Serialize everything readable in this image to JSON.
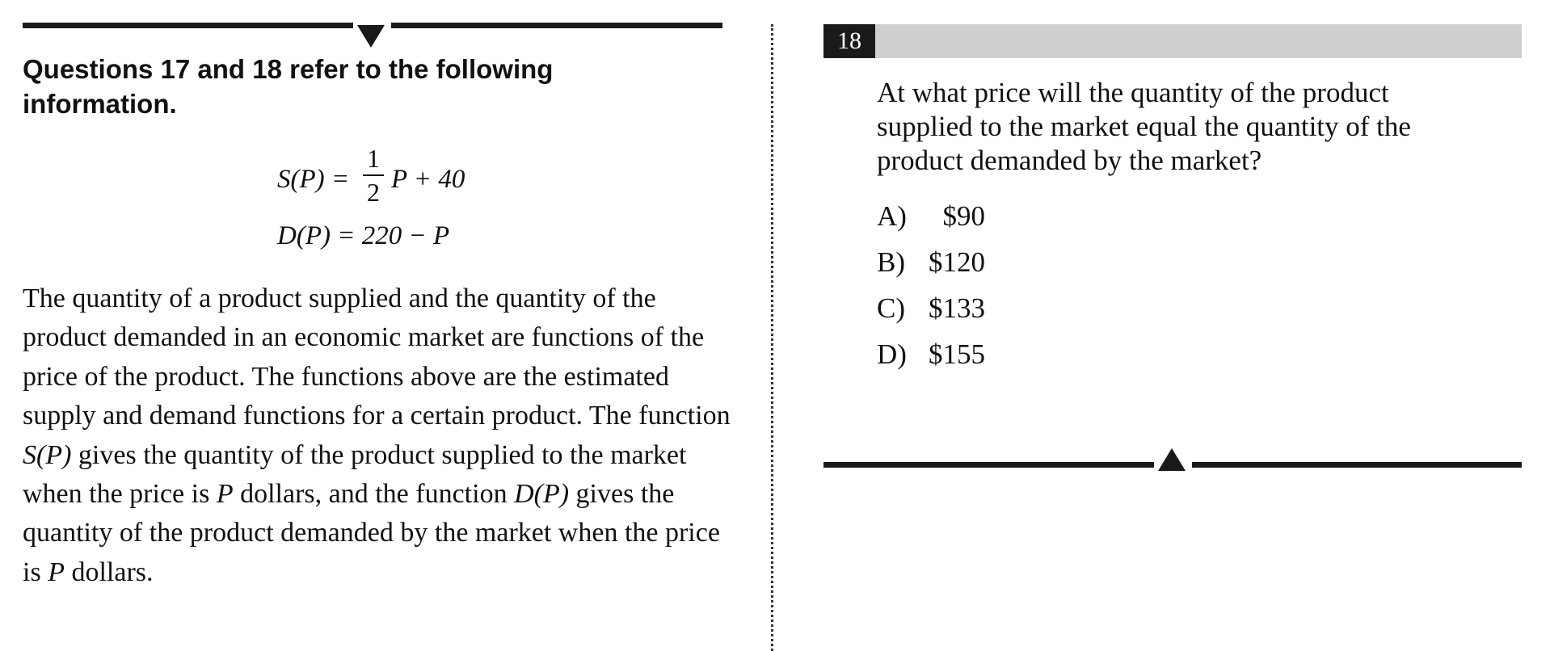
{
  "heading": "Questions 17 and 18 refer to the following information.",
  "equations": {
    "supply_lhs": "S(P) =",
    "fraction_numerator": "1",
    "fraction_denominator": "2",
    "supply_rhs": "P + 40",
    "demand": "D(P) = 220 − P"
  },
  "passage": {
    "part1": "The quantity of a product supplied and the quantity of the product demanded in an economic market are functions of the price of the product.  The functions above are the estimated supply and demand functions for a certain product.  The function ",
    "s_of_p": "S(P)",
    "part2": " gives the quantity of the product supplied to the market when the price is ",
    "p1": "P",
    "part3": " dollars, and the function ",
    "d_of_p": "D(P)",
    "part4": " gives the quantity of the product demanded by the market when the price is ",
    "p2": "P",
    "part5": " dollars."
  },
  "question_number": "18",
  "question_text": "At what price will the quantity of the product supplied to the market equal the quantity of the product demanded by the market?",
  "choices": [
    {
      "letter": "A)",
      "text": "  $90"
    },
    {
      "letter": "B)",
      "text": "$120"
    },
    {
      "letter": "C)",
      "text": "$133"
    },
    {
      "letter": "D)",
      "text": "$155"
    }
  ]
}
